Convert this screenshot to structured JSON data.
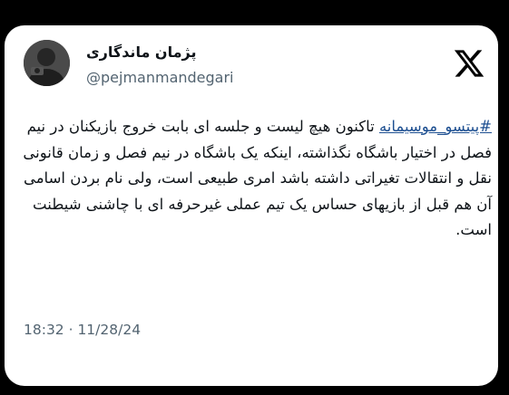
{
  "tweet": {
    "display_name": "پژمان ماندگاری",
    "handle": "@pejmanmandegari",
    "hashtag": "#پیتسو_موسیمانه",
    "body": " تاکنون هیچ لیست و جلسه ای بابت خروج بازیکنان در نیم فصل در اختیار باشگاه نگذاشته، اینکه یک باشگاه در نیم فصل و زمان قانونی نقل و انتقالات تغیراتی داشته باشد امری طبیعی است، ولی نام بردن اسامی آن هم قبل از بازیهای حساس یک تیم عملی غیرحرفه ای با چاشنی شیطنت است.",
    "timestamp": "18:32 · 11/28/24"
  },
  "icons": {
    "logo": "x-logo-icon",
    "avatar": "profile-photo"
  },
  "colors": {
    "background": "#000000",
    "card": "#ffffff",
    "text": "#0f1419",
    "secondary_text": "#536471",
    "hashtag": "#1d4f91"
  }
}
